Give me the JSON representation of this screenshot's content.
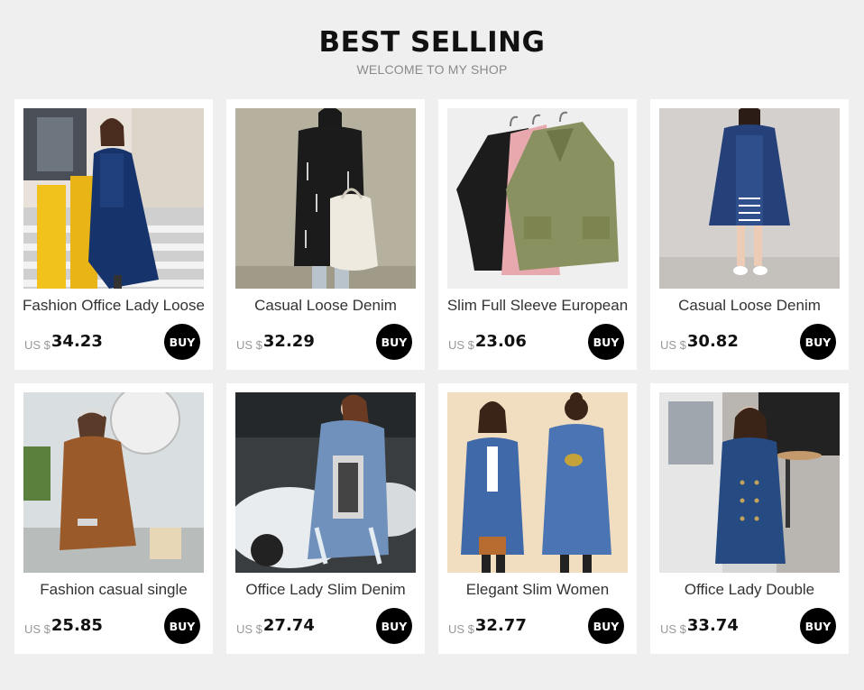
{
  "header": {
    "title": "BEST SELLING",
    "subtitle": "WELCOME TO MY SHOP"
  },
  "products": [
    {
      "name": "Fashion Office Lady Loose",
      "currency": "US $",
      "price": "34.23",
      "buy_label": "BUY",
      "image": "model-yellow-pillars-navy-denim-coat"
    },
    {
      "name": "Casual Loose Denim",
      "currency": "US $",
      "price": "32.29",
      "buy_label": "BUY",
      "image": "model-black-coat-white-backpack"
    },
    {
      "name": "Slim Full Sleeve European",
      "currency": "US $",
      "price": "23.06",
      "buy_label": "BUY",
      "image": "three-coats-on-hangers"
    },
    {
      "name": "Casual Loose Denim",
      "currency": "US $",
      "price": "30.82",
      "buy_label": "BUY",
      "image": "model-denim-coat-striped-dress"
    },
    {
      "name": "Fashion casual single",
      "currency": "US $",
      "price": "25.85",
      "buy_label": "BUY",
      "image": "model-brown-trench-coat-outdoor"
    },
    {
      "name": "Office Lady Slim Denim",
      "currency": "US $",
      "price": "27.74",
      "buy_label": "BUY",
      "image": "model-back-view-denim-coat-car"
    },
    {
      "name": "Elegant Slim Women",
      "currency": "US $",
      "price": "32.77",
      "buy_label": "BUY",
      "image": "model-front-back-denim-coat"
    },
    {
      "name": "Office Lady Double",
      "currency": "US $",
      "price": "33.74",
      "buy_label": "BUY",
      "image": "model-double-breasted-denim-coat"
    }
  ],
  "colors": {
    "page_bg": "#efefef",
    "card_bg": "#ffffff",
    "buy_bg": "#000000",
    "buy_text": "#ffffff"
  }
}
